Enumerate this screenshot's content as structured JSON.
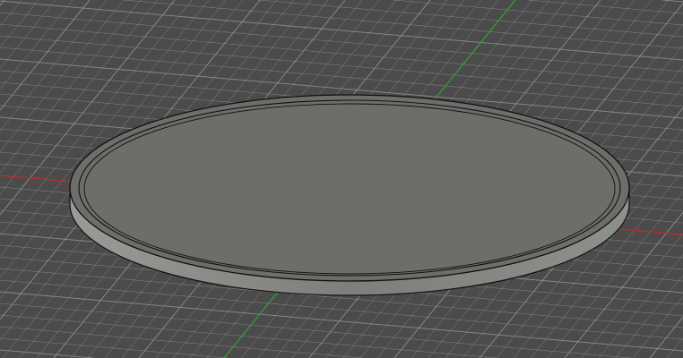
{
  "viewport": {
    "background_color": "#4b4b4b",
    "grid_color": "#9a9a9a",
    "x_axis_color": "#c0282a",
    "y_axis_color": "#2fa02f"
  },
  "model": {
    "name": "disc",
    "top_color": "#6d6d69",
    "rim_color": "#8e8e8b",
    "edge_color": "#111111"
  }
}
